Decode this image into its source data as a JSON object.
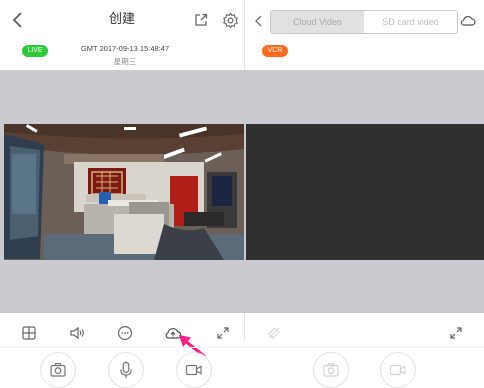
{
  "header": {
    "back_icon": "chevron-left-icon",
    "title": "创建",
    "share_icon": "share-icon",
    "settings_icon": "gear-icon",
    "right_back_icon": "chevron-left-icon",
    "tabs": [
      {
        "label": "Cloud Video",
        "active": true
      },
      {
        "label": "SD card video",
        "active": false
      }
    ],
    "cloud_icon": "cloud-icon"
  },
  "live_panel": {
    "badge": "LIVE",
    "badge_color": "#2ec93a",
    "timestamp": "GMT 2017-09-13 15:48:47",
    "weekday": "星期三"
  },
  "playback_panel": {
    "badge": "VCR",
    "badge_color": "#ff6a1f"
  },
  "toolbar_left": [
    {
      "name": "grid-icon"
    },
    {
      "name": "speaker-icon"
    },
    {
      "name": "chat-icon"
    },
    {
      "name": "cloud-upload-icon"
    },
    {
      "name": "fullscreen-icon"
    }
  ],
  "toolbar_right": [
    {
      "name": "mute-icon"
    },
    {
      "name": "fullscreen-icon"
    }
  ],
  "controls_left": [
    {
      "name": "camera-icon"
    },
    {
      "name": "microphone-icon"
    },
    {
      "name": "video-record-icon"
    }
  ],
  "controls_right": [
    {
      "name": "camera-icon"
    },
    {
      "name": "video-record-icon"
    }
  ],
  "annotation": {
    "name": "arrow-icon",
    "color": "#ff1f87"
  }
}
